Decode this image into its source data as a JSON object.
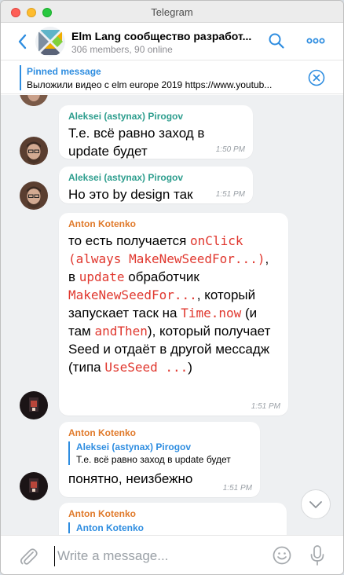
{
  "window": {
    "title": "Telegram"
  },
  "header": {
    "chat_title": "Elm Lang сообщество разработ...",
    "subtitle": "306 members, 90 online"
  },
  "pinned": {
    "title": "Pinned message",
    "text": "Выложили видео с elm europe 2019 https://www.youtub..."
  },
  "messages": [
    {
      "sender": "Aleksei (astynax) Pirogov",
      "text": "Т.е. всё равно заход в update будет",
      "time": "1:50 PM"
    },
    {
      "sender": "Aleksei (astynax) Pirogov",
      "text": "Но это by design так",
      "time": "1:51 PM"
    },
    {
      "sender": "Anton Kotenko",
      "parts": [
        "то есть получается ",
        "onClick (always MakeNewSeedFor...)",
        ", в ",
        "update",
        " обработчик ",
        "MakeNewSeedFor...",
        ", который запускает таск на ",
        "Time.now",
        " (и там ",
        "andThen",
        "), который получает Seed и отдаёт в другой мессадж (типа ",
        "UseSeed ...",
        ")"
      ],
      "time": "1:51 PM"
    },
    {
      "sender": "Anton Kotenko",
      "reply_author": "Aleksei (astynax) Pirogov",
      "reply_text": "Т.е. всё равно заход в update будет",
      "text": "понятно, неизбежно",
      "time": "1:51 PM"
    },
    {
      "sender": "Anton Kotenko",
      "reply_author": "Anton Kotenko"
    }
  ],
  "composer": {
    "placeholder": "Write a message..."
  },
  "colors": {
    "accent": "#2e8de0",
    "sender_green": "#2e9e8e",
    "sender_orange": "#e07a2b",
    "code_red": "#e0372e"
  },
  "icons": [
    "back-icon",
    "group-avatar",
    "search-icon",
    "more-icon",
    "close-icon",
    "chevron-down-icon",
    "paperclip-icon",
    "emoji-icon",
    "microphone-icon"
  ]
}
